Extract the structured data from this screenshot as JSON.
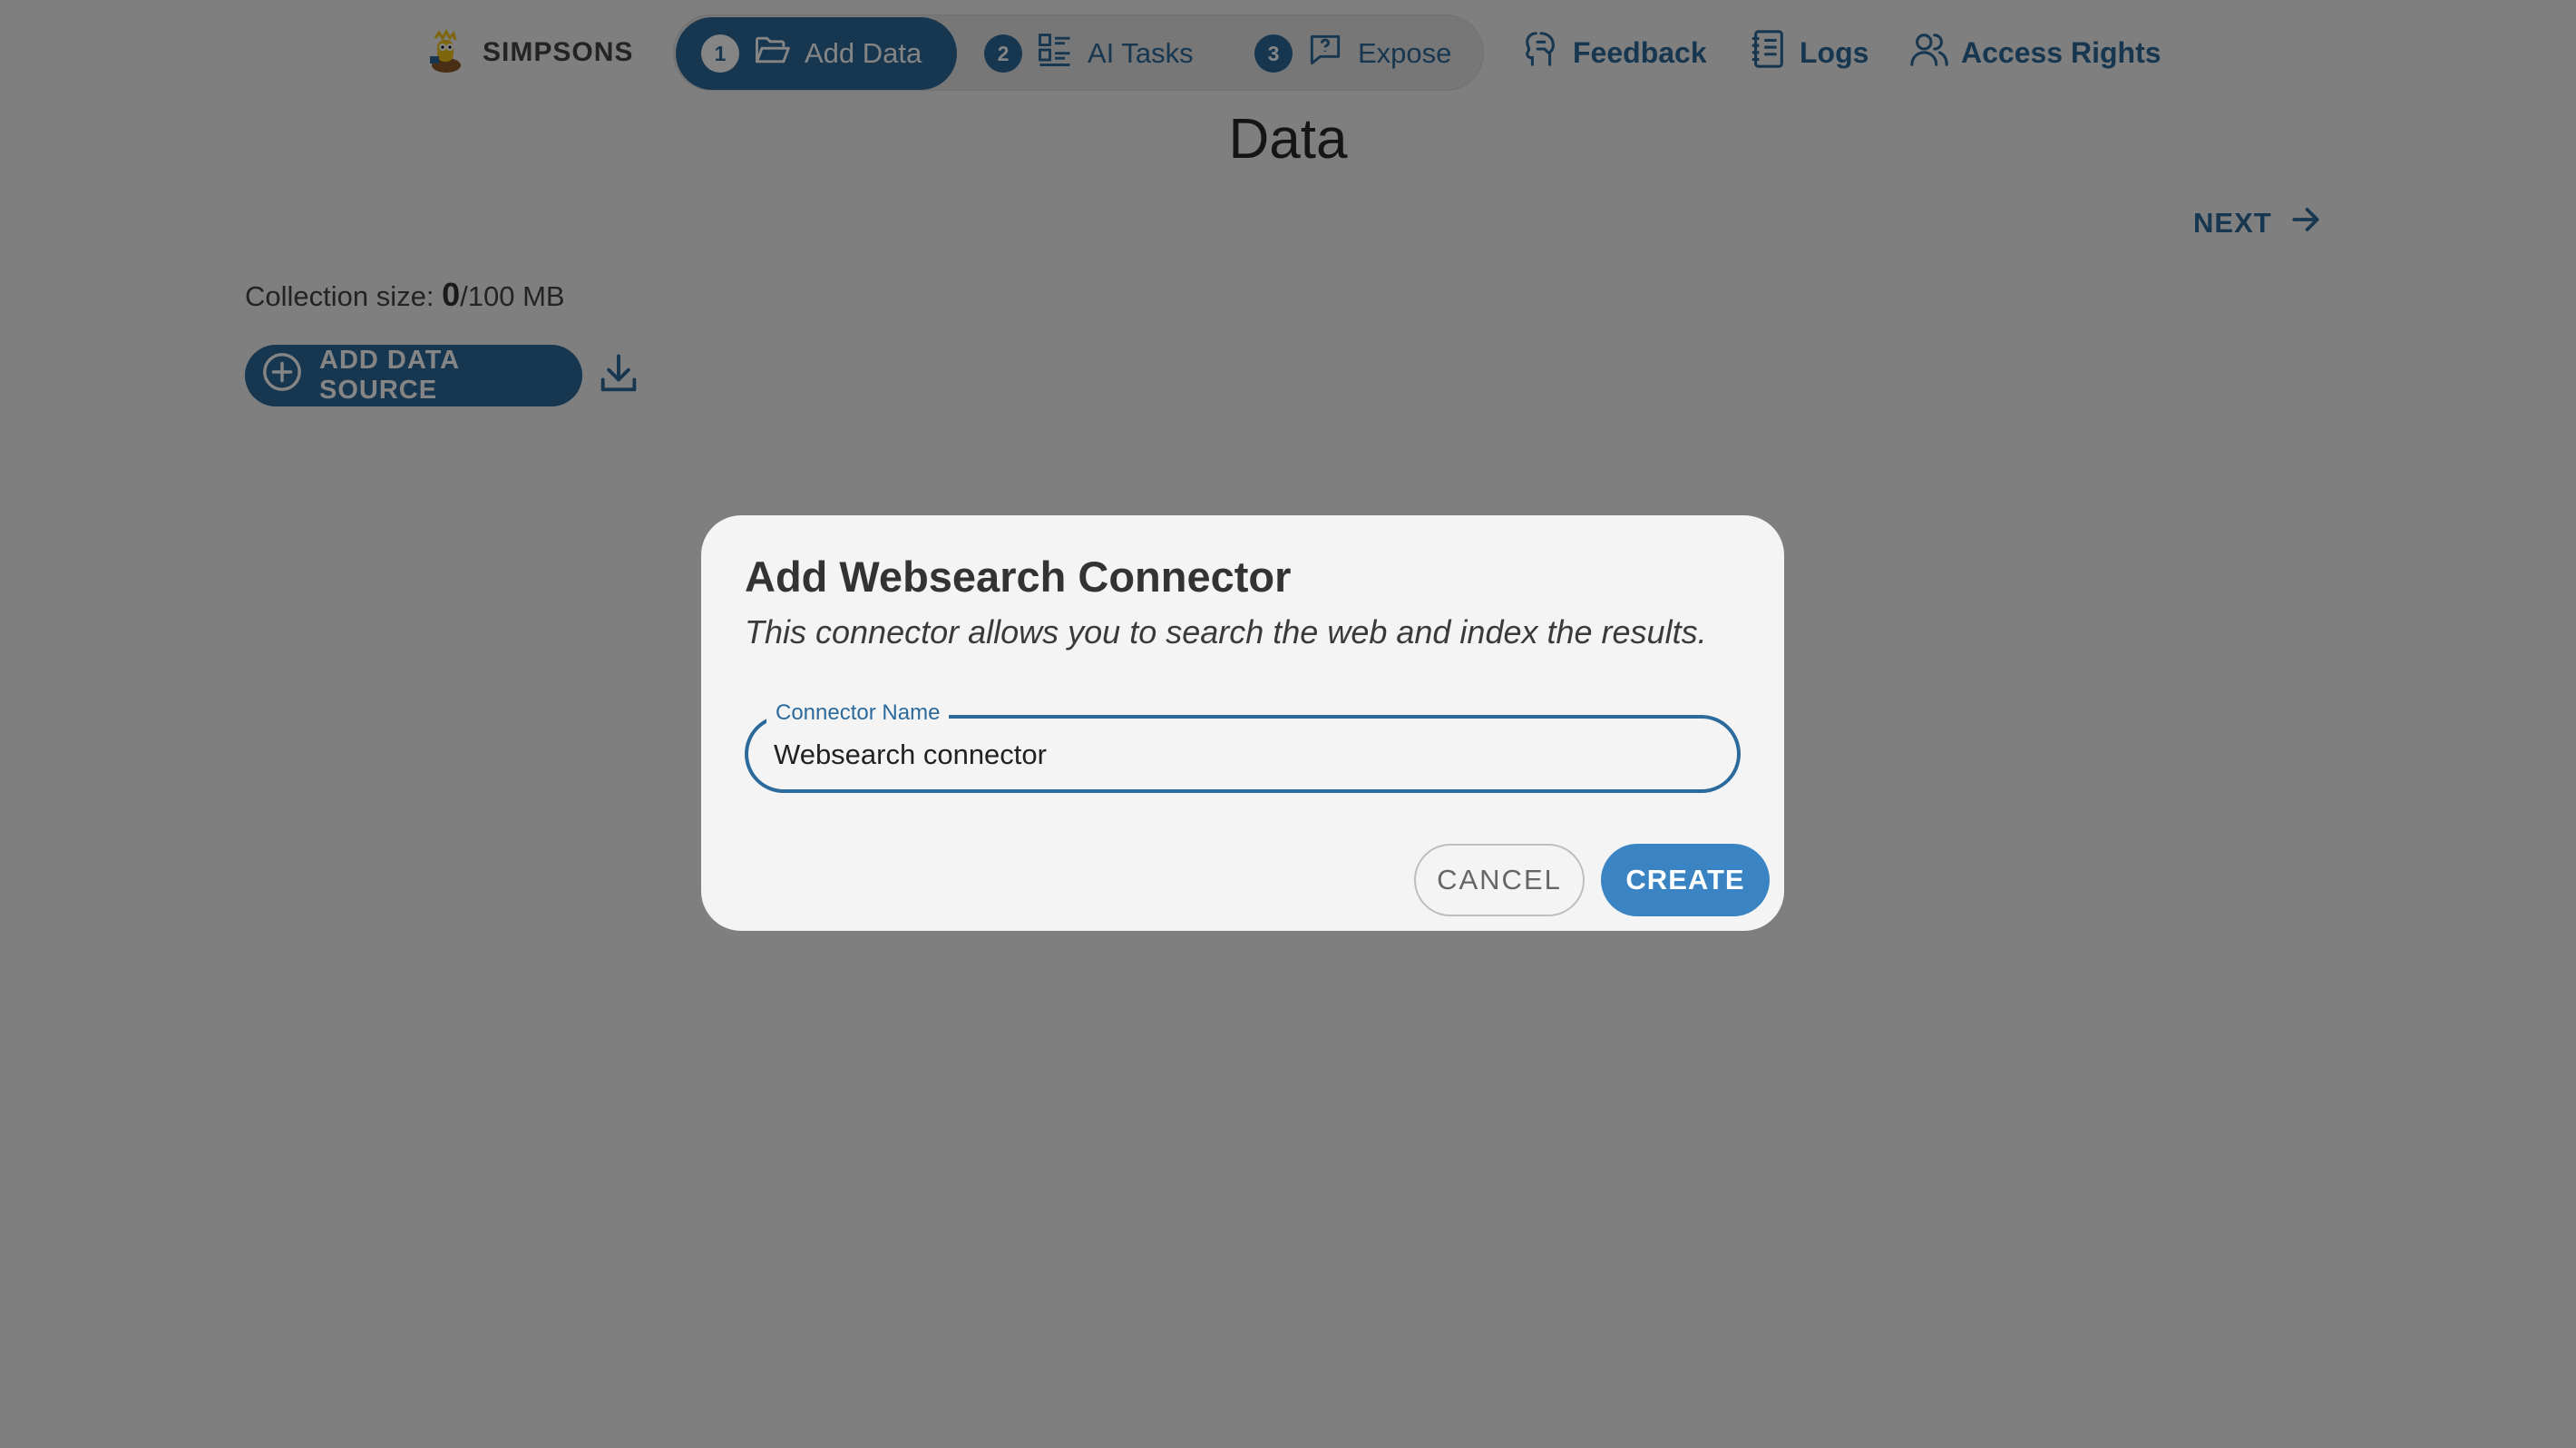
{
  "brand": {
    "name": "SIMPSONS"
  },
  "stepper": {
    "steps": [
      {
        "number": "1",
        "label": "Add Data",
        "active": true
      },
      {
        "number": "2",
        "label": "AI Tasks",
        "active": false
      },
      {
        "number": "3",
        "label": "Expose",
        "active": false
      }
    ]
  },
  "topnav": {
    "feedback": "Feedback",
    "logs": "Logs",
    "access_rights": "Access Rights"
  },
  "page": {
    "title": "Data",
    "next_label": "NEXT",
    "collection_size_label": "Collection size: ",
    "collection_size_value": "0",
    "collection_size_limit": "/100 MB",
    "add_source_label": "ADD DATA SOURCE"
  },
  "dialog": {
    "title": "Add Websearch Connector",
    "description": "This connector allows you to search the web and index the results.",
    "field_label": "Connector Name",
    "field_value": "Websearch connector",
    "cancel_label": "CANCEL",
    "create_label": "CREATE"
  },
  "colors": {
    "primary": "#2d6a9c",
    "create_button": "#3a84c4",
    "overlay": "rgba(0,0,0,0.48)"
  }
}
